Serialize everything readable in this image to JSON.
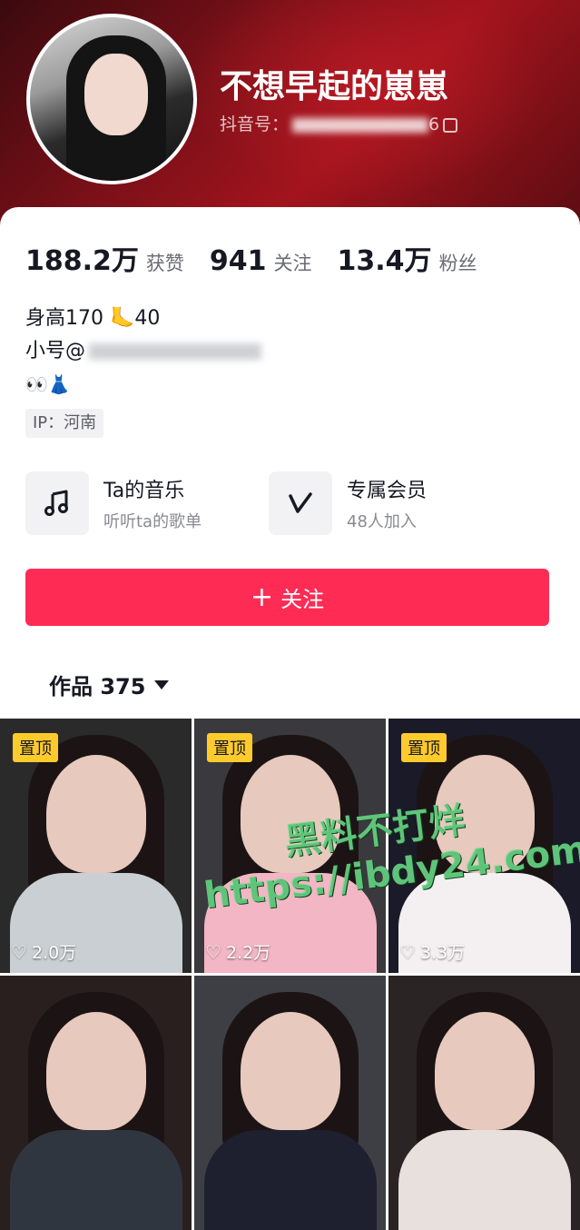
{
  "profile": {
    "nickname": "不想早起的崽崽",
    "id_label": "抖音号：",
    "id_suffix": "6"
  },
  "stats": [
    {
      "value": "188.2万",
      "label": "获赞"
    },
    {
      "value": "941",
      "label": "关注"
    },
    {
      "value": "13.4万",
      "label": "粉丝"
    }
  ],
  "bio": {
    "line1": "身高170 🦶40",
    "line2_prefix": "小号@",
    "line3": "👀👗"
  },
  "ip": "IP：河南",
  "features": {
    "music": {
      "title": "Ta的音乐",
      "sub": "听听ta的歌单",
      "icon": "music-note-icon"
    },
    "member": {
      "title": "专属会员",
      "sub": "48人加入",
      "icon": "v-badge-icon"
    }
  },
  "follow_button": "关注",
  "works_tab": "作品 375",
  "videos": [
    {
      "pinned": true,
      "pin_label": "置顶",
      "likes": "2.0万",
      "bg": "#2a2a2a",
      "cloth": "#c9cfd2"
    },
    {
      "pinned": true,
      "pin_label": "置顶",
      "likes": "2.2万",
      "bg": "#3a3a3e",
      "cloth": "#f2b6c4"
    },
    {
      "pinned": true,
      "pin_label": "置顶",
      "likes": "3.3万",
      "bg": "#1a1a28",
      "cloth": "#f4f0f2"
    },
    {
      "pinned": false,
      "pin_label": "",
      "likes": "",
      "bg": "#2a1f1f",
      "cloth": "#303640"
    },
    {
      "pinned": false,
      "pin_label": "",
      "likes": "",
      "bg": "#3d3f44",
      "cloth": "#1e2030"
    },
    {
      "pinned": false,
      "pin_label": "",
      "likes": "",
      "bg": "#2b2424",
      "cloth": "#e8e0dc"
    }
  ],
  "watermark": {
    "line1": "黑料不打烊",
    "line2": "https://ibdy24.com"
  },
  "colors": {
    "accent": "#fe2c55",
    "pin": "#ffcb2c",
    "header": "#a3141d"
  }
}
